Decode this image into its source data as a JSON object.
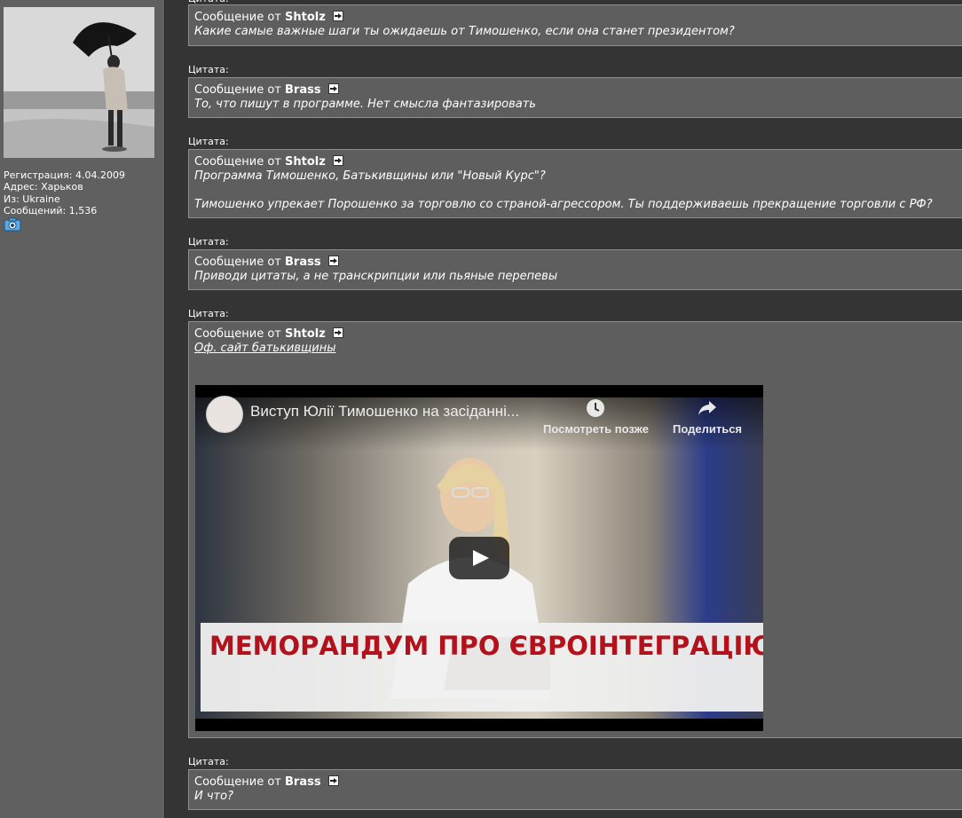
{
  "user": {
    "registration": "Регистрация: 4.04.2009",
    "address": "Адрес: Харьков",
    "from": "Из: Ukraine",
    "posts": "Сообщений: 1,536"
  },
  "colors": {
    "page_bg": "#343434",
    "sidebar_bg": "#606060",
    "quote_bg": "#5e5e5e",
    "banner_text": "#b3121c"
  },
  "quote_label": "Цитата:",
  "header_prefix": "Сообщение от",
  "quotes": [
    {
      "author": "Shtolz",
      "lines": [
        "Какие самые важные шаги ты ожидаешь от Тимошенко, если она станет президентом?"
      ]
    },
    {
      "author": "Brass",
      "lines": [
        "То, что пишут в программе. Нет смысла фантазировать"
      ]
    },
    {
      "author": "Shtolz",
      "lines": [
        "Программа Тимошенко, Батькивщины или \"Новый Курс\"?",
        "",
        "Тимошенко упрекает Порошенко за торговлю со страной-агрессором. Ты поддерживаешь прекращение торговли с РФ?"
      ]
    },
    {
      "author": "Brass",
      "lines": [
        "Приводи цитаты, а не транскрипции или пьяные перепевы"
      ]
    },
    {
      "author": "Shtolz",
      "link": "Оф. сайт батькивщины"
    },
    {
      "author": "Brass",
      "lines": [
        "И что?"
      ]
    }
  ],
  "video": {
    "title": "Виступ Юлії Тимошенко на засіданні...",
    "watch_later": "Посмотреть позже",
    "share": "Поделиться",
    "banner": "МЕМОРАНДУМ ПРО ЄВРОІНТЕГРАЦІЮ",
    "icons": [
      "clock-icon",
      "share-arrow-icon",
      "play-icon"
    ]
  }
}
